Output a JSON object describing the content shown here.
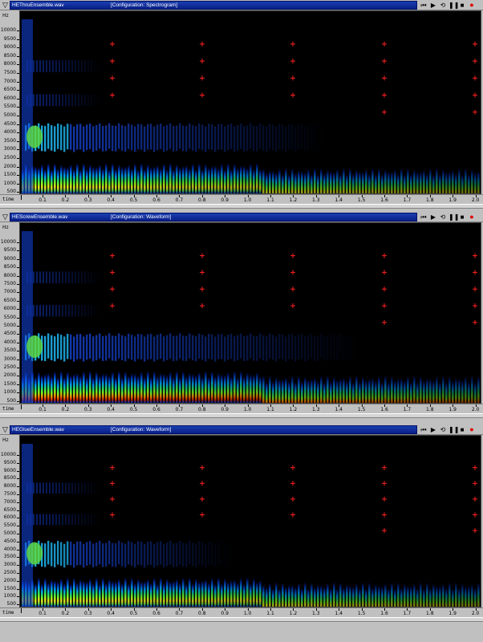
{
  "windows": [
    {
      "file": "HEThruEnsemble.wav",
      "config": "[Configuration: Spectrogram]"
    },
    {
      "file": "HEScrewEnsemble.wav",
      "config": "[Configuration: Waveform]"
    },
    {
      "file": "HEGlueEnsemble.wav",
      "config": "[Configuration: Waveform]"
    }
  ],
  "controls": {
    "menu": "▽",
    "rewind": "⏮",
    "play": "▶",
    "loop": "⟲",
    "pause": "❚❚",
    "stop": "■",
    "record": "●"
  },
  "y_unit": "Hz",
  "x_label": "time",
  "y_ticks": [
    "10000",
    "9500",
    "9000",
    "8500",
    "8000",
    "7500",
    "7000",
    "6500",
    "6000",
    "5500",
    "5000",
    "4500",
    "4000",
    "3500",
    "3000",
    "2500",
    "2000",
    "1500",
    "1000",
    "500"
  ],
  "x_ticks": [
    "0.1",
    "0.2",
    "0.3",
    "0.4",
    "0.5",
    "0.6",
    "0.7",
    "0.8",
    "0.9",
    "1.0",
    "1.1",
    "1.2",
    "1.3",
    "1.4",
    "1.5",
    "1.6",
    "1.7",
    "1.8",
    "1.9",
    "2.0"
  ],
  "colors": {
    "title_bar": "#0a2a9c",
    "plot_bg": "#000000",
    "marker": "#ff2020",
    "record": "#e00000"
  }
}
